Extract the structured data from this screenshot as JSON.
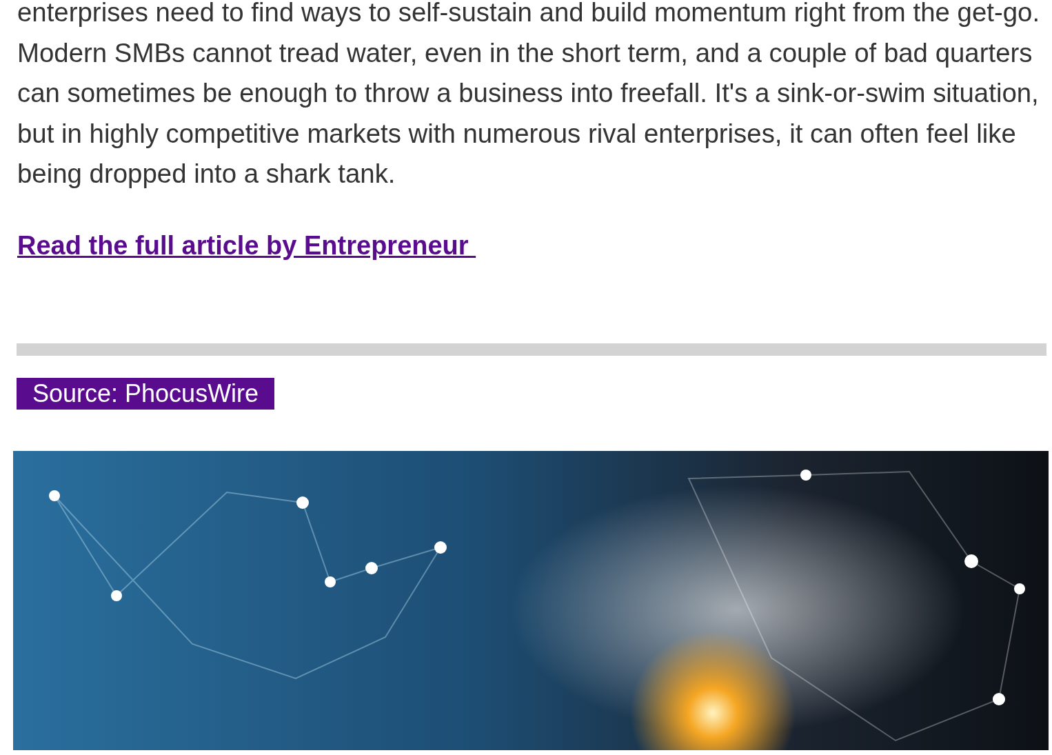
{
  "article": {
    "paragraph": "enterprises need to find ways to self-sustain and build momentum right from the get-go. Modern SMBs cannot tread water, even in the short term, and a couple of bad quarters can sometimes be enough to throw a business into freefall. It's a sink-or-swim situation, but in highly competitive markets with numerous rival enterprises, it can often feel like being dropped into a shark tank.",
    "link": "Read the full article by Entrepreneur "
  },
  "source_badge": "Source: PhocusWire"
}
